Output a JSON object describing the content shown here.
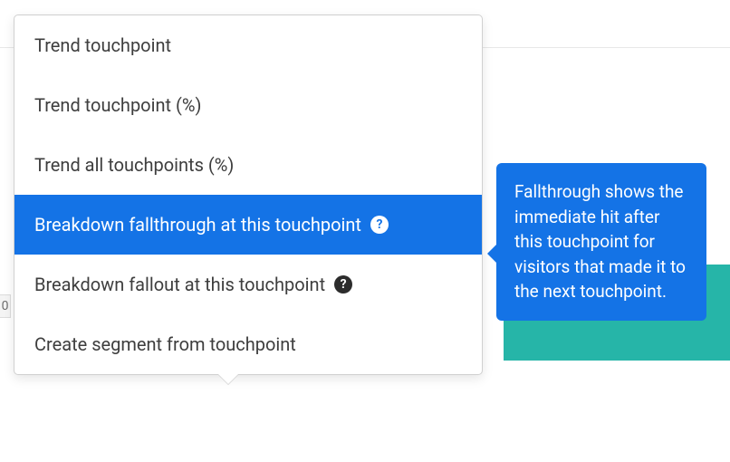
{
  "background": {
    "stripe_label": "0"
  },
  "menu": {
    "items": [
      {
        "label": "Trend touchpoint",
        "selected": false,
        "hasHelp": false
      },
      {
        "label": "Trend touchpoint (%)",
        "selected": false,
        "hasHelp": false
      },
      {
        "label": "Trend all touchpoints (%)",
        "selected": false,
        "hasHelp": false
      },
      {
        "label": "Breakdown fallthrough at this touchpoint",
        "selected": true,
        "hasHelp": true
      },
      {
        "label": "Breakdown fallout at this touchpoint",
        "selected": false,
        "hasHelp": true
      },
      {
        "label": "Create segment from touchpoint",
        "selected": false,
        "hasHelp": false
      }
    ]
  },
  "tooltip": {
    "text": "Fallthrough shows the immediate hit after this touchpoint for visitors that made it to the next touchpoint."
  },
  "help_glyph": "?"
}
